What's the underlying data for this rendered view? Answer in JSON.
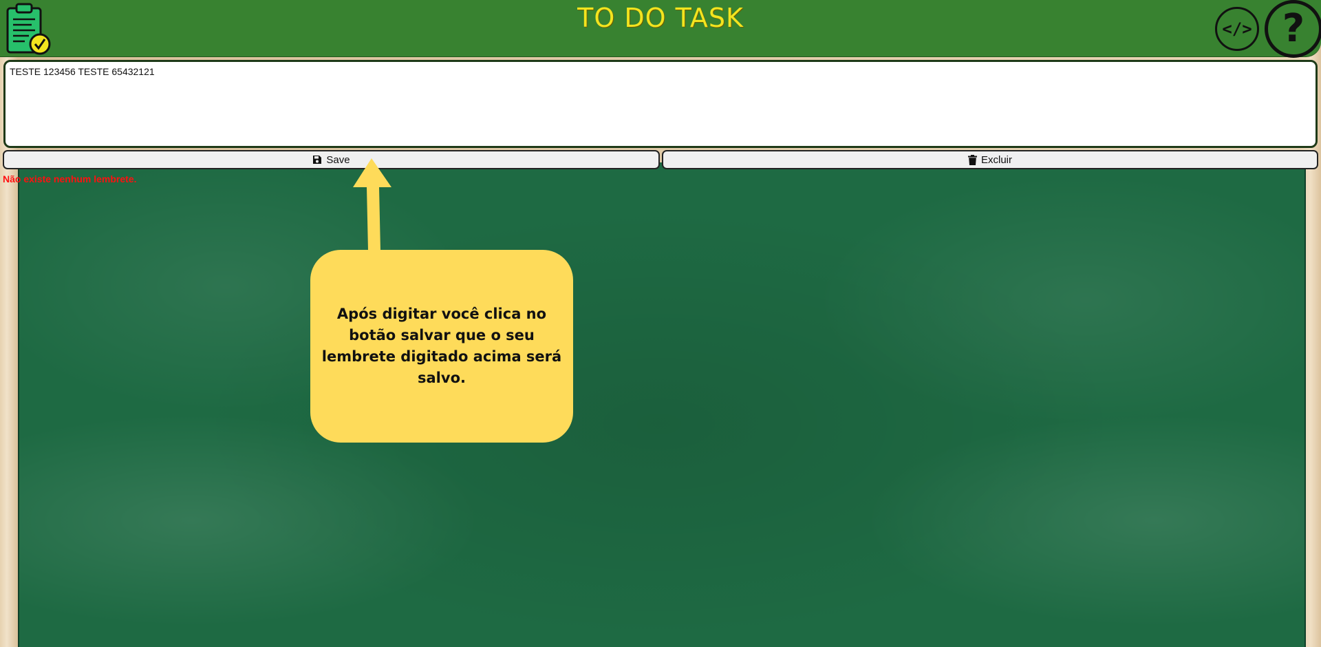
{
  "header": {
    "title": "TO DO TASK",
    "logo_icon": "clipboard-check-icon",
    "code_button_label": "</>",
    "help_button_label": "?"
  },
  "editor": {
    "value": "TESTE 123456 TESTE 65432121"
  },
  "actions": {
    "save_label": "Save",
    "save_icon": "floppy-disk-icon",
    "delete_label": "Excluir",
    "delete_icon": "trash-icon"
  },
  "status": {
    "empty_message": "Não existe nenhum lembrete."
  },
  "tutorial": {
    "tooltip_text": "Após digitar você clica no botão salvar que o seu lembrete digitado acima será salvo."
  },
  "colors": {
    "header_bg": "#388230",
    "title": "#f3e41f",
    "chalkboard": "#1e6a43",
    "tooltip_bg": "#fedb5a",
    "error_text": "#ff1010"
  }
}
